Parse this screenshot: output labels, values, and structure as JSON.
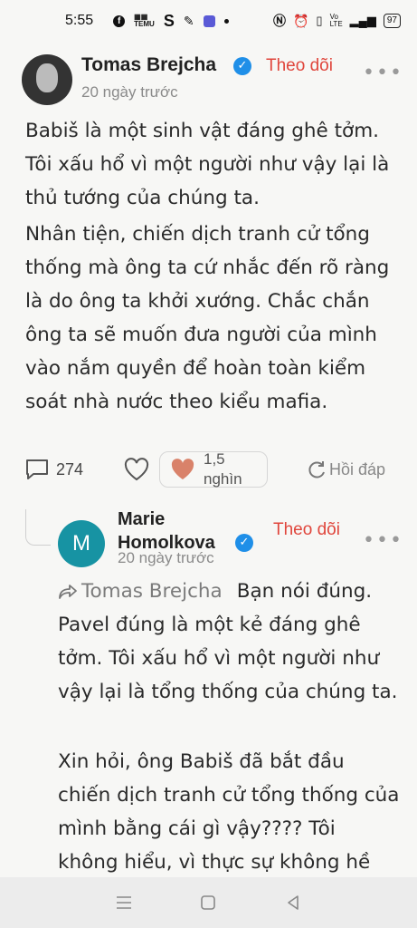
{
  "status_bar": {
    "time": "5:55",
    "battery": "97",
    "icons": [
      "facebook-icon",
      "temu-icon",
      "s-icon",
      "gallery-icon",
      "app-icon",
      "dot-icon",
      "nfc-icon",
      "alarm-icon",
      "vibrate-icon",
      "volte-icon",
      "signal-icon",
      "battery-icon"
    ]
  },
  "post": {
    "author": "Tomas Brejcha",
    "follow_label": "Theo dõi",
    "time_ago": "20 ngày trước",
    "paragraphs": [
      "Babiš là một sinh vật đáng ghê tởm. Tôi xấu hổ vì một người như vậy lại là thủ tướng của chúng ta.",
      "Nhân tiện, chiến dịch tranh cử tổng thống mà ông ta cứ nhắc đến rõ ràng là do ông ta khởi xướng. Chắc chắn ông ta sẽ muốn đưa người của mình vào nắm quyền để hoàn toàn kiểm soát nhà nước theo kiểu mafia."
    ],
    "comments_count": "274",
    "reactions_count": "1,5 nghìn",
    "reply_label": "Hồi đáp"
  },
  "reply": {
    "avatar_letter": "M",
    "author_line1": "Marie",
    "author_line2": "Homolkova",
    "follow_label": "Theo dõi",
    "time_ago": "20 ngày trước",
    "mention": "Tomas Brejcha",
    "text1": "Bạn nói đúng. Pavel đúng là một kẻ đáng ghê tởm. Tôi xấu hổ vì một người như vậy lại là tổng thống của chúng ta.",
    "text2": "Xin hỏi, ông Babiš đã bắt đầu chiến dịch tranh cử tổng thống của mình bằng cái gì vậy???? Tôi không hiểu, vì thực sự không hề"
  },
  "colors": {
    "follow": "#e0463c",
    "verified": "#1f8fe8",
    "reply_avatar": "#1793a3",
    "heart": "#d9826a"
  }
}
